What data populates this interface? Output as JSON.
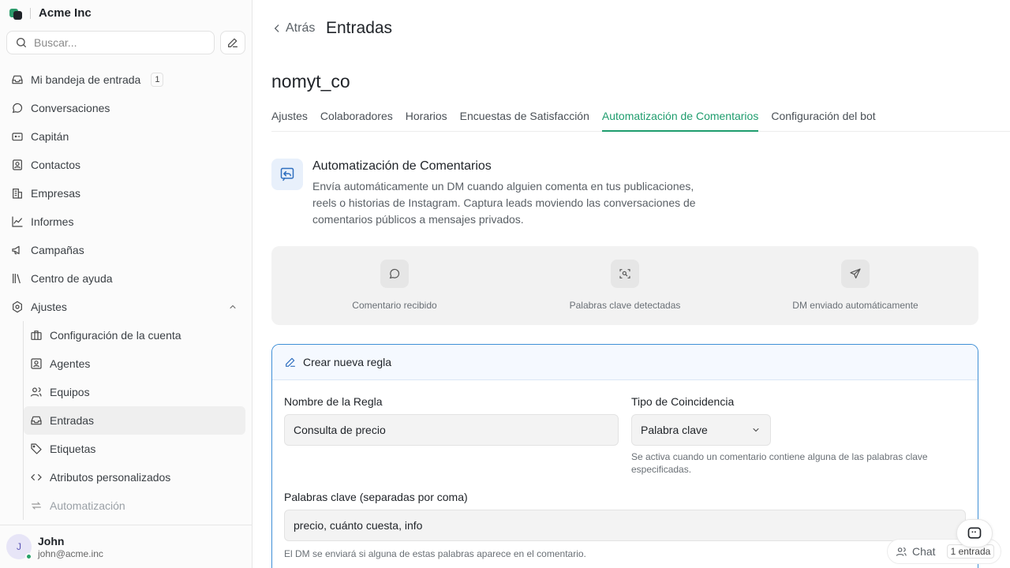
{
  "workspace": {
    "name": "Acme Inc"
  },
  "search": {
    "placeholder": "Buscar..."
  },
  "sidebar": {
    "items": [
      {
        "label": "Mi bandeja de entrada",
        "badge": "1"
      },
      {
        "label": "Conversaciones"
      },
      {
        "label": "Capitán"
      },
      {
        "label": "Contactos"
      },
      {
        "label": "Empresas"
      },
      {
        "label": "Informes"
      },
      {
        "label": "Campañas"
      },
      {
        "label": "Centro de ayuda"
      },
      {
        "label": "Ajustes"
      }
    ],
    "settings_items": [
      {
        "label": "Configuración de la cuenta"
      },
      {
        "label": "Agentes"
      },
      {
        "label": "Equipos"
      },
      {
        "label": "Entradas"
      },
      {
        "label": "Etiquetas"
      },
      {
        "label": "Atributos personalizados"
      },
      {
        "label": "Automatización"
      }
    ]
  },
  "user": {
    "initial": "J",
    "name": "John",
    "email": "john@acme.inc"
  },
  "header": {
    "back_label": "Atrás",
    "title": "Entradas"
  },
  "inbox": {
    "name": "nomyt_co"
  },
  "tabs": [
    {
      "label": "Ajustes"
    },
    {
      "label": "Colaboradores"
    },
    {
      "label": "Horarios"
    },
    {
      "label": "Encuestas de Satisfacción"
    },
    {
      "label": "Automatización de Comentarios",
      "active": true
    },
    {
      "label": "Configuración del bot"
    }
  ],
  "feature": {
    "title": "Automatización de Comentarios",
    "description": "Envía automáticamente un DM cuando alguien comenta en tus publicaciones, reels o historias de Instagram. Captura leads moviendo las conversaciones de comentarios públicos a mensajes privados."
  },
  "flow": {
    "steps": [
      {
        "label": "Comentario recibido",
        "icon": "message-circle-icon"
      },
      {
        "label": "Palabras clave detectadas",
        "icon": "scan-search-icon"
      },
      {
        "label": "DM enviado automáticamente",
        "icon": "send-icon"
      }
    ]
  },
  "rule_form": {
    "title": "Crear nueva regla",
    "name_label": "Nombre de la Regla",
    "name_value": "Consulta de precio",
    "match_label": "Tipo de Coincidencia",
    "match_value": "Palabra clave",
    "match_hint": "Se activa cuando un comentario contiene alguna de las palabras clave especificadas.",
    "keywords_label": "Palabras clave (separadas por coma)",
    "keywords_value": "precio, cuánto cuesta, info",
    "keywords_hint": "El DM se enviará si alguna de estas palabras aparece en el comentario."
  },
  "chat_widget": {
    "label": "Chat",
    "count": "1 entrada"
  },
  "colors": {
    "accent": "#1f9d6e",
    "focus_border": "#3f8fd6",
    "feature_icon": "#2f6fbf"
  }
}
